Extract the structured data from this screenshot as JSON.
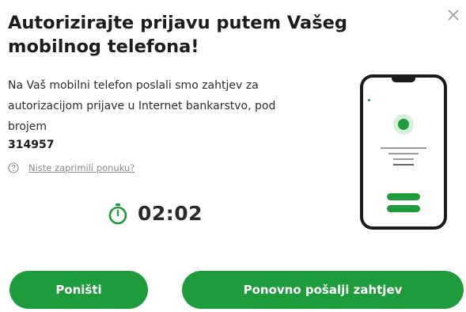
{
  "dialog": {
    "title": "Autorizirajte prijavu putem Vašeg mobilnog telefona!",
    "description": "Na Vaš mobilni telefon poslali smo zahtjev za autorizacijom prijave u Internet bankarstvo, pod brojem",
    "request_number": "314957",
    "help_link": "Niste zaprimili ponuku?",
    "timer": "02:02"
  },
  "buttons": {
    "cancel": "Poništi",
    "resend": "Ponovno pošalji zahtjev"
  },
  "colors": {
    "accent": "#1e9c3c",
    "text": "#222222",
    "muted": "#8a8a8a"
  },
  "icons": [
    "close-icon",
    "question-circle-icon",
    "stopwatch-icon"
  ]
}
